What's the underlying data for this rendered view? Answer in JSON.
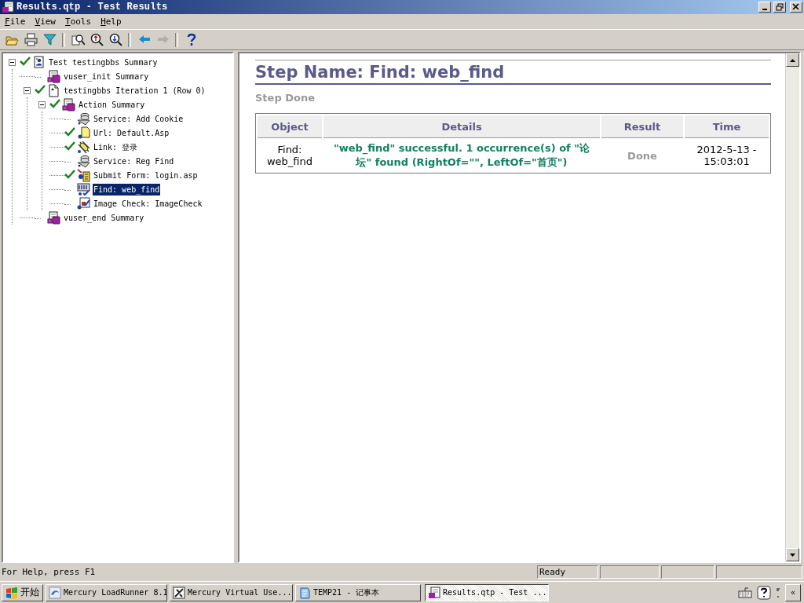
{
  "window": {
    "title": "Results.qtp - Test Results"
  },
  "menu": [
    "File",
    "View",
    "Tools",
    "Help"
  ],
  "toolbar": [
    {
      "kind": "open",
      "disabled": false
    },
    {
      "kind": "print",
      "disabled": false
    },
    {
      "kind": "filter",
      "disabled": false
    },
    {
      "kind": "sep"
    },
    {
      "kind": "find",
      "disabled": false
    },
    {
      "kind": "zoom-in",
      "disabled": false
    },
    {
      "kind": "zoom-out",
      "disabled": false
    },
    {
      "kind": "sep"
    },
    {
      "kind": "back",
      "disabled": false
    },
    {
      "kind": "forward",
      "disabled": true
    },
    {
      "kind": "sep"
    },
    {
      "kind": "help",
      "disabled": false
    }
  ],
  "tree": [
    {
      "label": "Test testingbbs Summary",
      "kind": "test",
      "passed": true,
      "selected": false,
      "expanded": true,
      "children": [
        {
          "label": "vuser_init Summary",
          "kind": "vuser",
          "passed": false,
          "selected": false
        },
        {
          "label": "testingbbs Iteration 1 (Row 0)",
          "kind": "iteration",
          "passed": true,
          "selected": false,
          "expanded": true,
          "children": [
            {
              "label": "Action Summary",
              "kind": "vuser",
              "passed": true,
              "selected": false,
              "expanded": true,
              "children": [
                {
                  "label": "Service: Add Cookie",
                  "kind": "service",
                  "passed": false,
                  "selected": false
                },
                {
                  "label": "Url: Default.Asp",
                  "kind": "url",
                  "passed": true,
                  "selected": false
                },
                {
                  "label": "Link: 登录",
                  "kind": "link",
                  "passed": true,
                  "selected": false
                },
                {
                  "label": "Service: Reg Find",
                  "kind": "service",
                  "passed": false,
                  "selected": false
                },
                {
                  "label": "Submit Form: login.asp",
                  "kind": "form",
                  "passed": true,
                  "selected": false
                },
                {
                  "label": "Find: web_find",
                  "kind": "find",
                  "passed": false,
                  "selected": true
                },
                {
                  "label": "Image Check: ImageCheck",
                  "kind": "image",
                  "passed": false,
                  "selected": false
                }
              ]
            }
          ]
        },
        {
          "label": "vuser_end Summary",
          "kind": "vuser",
          "passed": false,
          "selected": false
        }
      ]
    }
  ],
  "report": {
    "step_name": "Step Name: Find: web_find",
    "status": "Step Done",
    "table": {
      "columns": [
        "Object",
        "Details",
        "Result",
        "Time"
      ],
      "rows": [
        {
          "object": "Find: web_find",
          "details": "\"web_find\" successful. 1 occurrence(s) of \"论坛\" found (RightOf=\"\", LeftOf=\"首页\")",
          "result": "Done",
          "time": "2012-5-13 - 15:03:01"
        }
      ]
    }
  },
  "status_bar": {
    "help": "For Help, press F1",
    "panel_1": "Ready"
  },
  "taskbar": {
    "start": "开始",
    "tasks": [
      {
        "label": "Mercury LoadRunner 8.1",
        "kind": "loadrunner",
        "selected": false
      },
      {
        "label": "Mercury Virtual Use...",
        "kind": "vugen",
        "selected": false
      },
      {
        "label": "TEMP21 - 记事本",
        "kind": "notepad",
        "selected": false
      },
      {
        "label": "Results.qtp - Test ...",
        "kind": "results",
        "selected": true
      }
    ],
    "tray_toggle": "«"
  }
}
